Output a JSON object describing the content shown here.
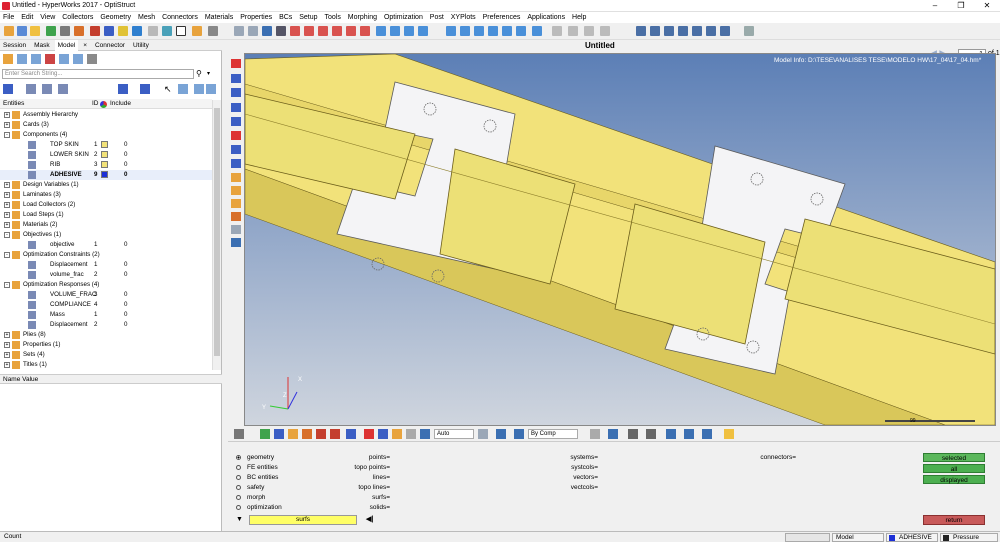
{
  "window": {
    "title": "Untitled - HyperWorks 2017 - OptiStruct"
  },
  "menu": [
    "File",
    "Edit",
    "View",
    "Collectors",
    "Geometry",
    "Mesh",
    "Connectors",
    "Materials",
    "Properties",
    "BCs",
    "Setup",
    "Tools",
    "Morphing",
    "Optimization",
    "Post",
    "XYPlots",
    "Preferences",
    "Applications",
    "Help"
  ],
  "pager": {
    "value": "1",
    "of": "of 1"
  },
  "graphics": {
    "title": "Untitled",
    "model_info": "Model Info: D:\\TESE\\ANALISES TESE\\MODELO HW\\17_04\\17_04.hm*",
    "scale": "99"
  },
  "browser": {
    "tabs": [
      "Session",
      "Mask",
      "Model",
      "Connector",
      "Utility"
    ],
    "active_tab": "Model",
    "search_placeholder": "Enter Search String...",
    "columns": {
      "entities": "Entities",
      "id": "ID",
      "include": "Include"
    },
    "tree": [
      {
        "label": "Assembly Hierarchy",
        "level": 0,
        "toggle": "+"
      },
      {
        "label": "Cards (3)",
        "level": 0,
        "toggle": "+"
      },
      {
        "label": "Components (4)",
        "level": 0,
        "toggle": "-"
      },
      {
        "label": "TOP SKIN",
        "level": 1,
        "id": "1",
        "include": "0",
        "color": "#f2e27a"
      },
      {
        "label": "LOWER SKIN",
        "level": 1,
        "id": "2",
        "include": "0",
        "color": "#f2e27a"
      },
      {
        "label": "RIB",
        "level": 1,
        "id": "3",
        "include": "0",
        "color": "#f2e27a"
      },
      {
        "label": "ADHESIVE",
        "level": 1,
        "id": "9",
        "include": "0",
        "color": "#1c2fd6",
        "bold": true
      },
      {
        "label": "Design Variables (1)",
        "level": 0,
        "toggle": "+"
      },
      {
        "label": "Laminates (3)",
        "level": 0,
        "toggle": "+"
      },
      {
        "label": "Load Collectors (2)",
        "level": 0,
        "toggle": "+"
      },
      {
        "label": "Load Steps (1)",
        "level": 0,
        "toggle": "+"
      },
      {
        "label": "Materials (2)",
        "level": 0,
        "toggle": "+"
      },
      {
        "label": "Objectives (1)",
        "level": 0,
        "toggle": "-"
      },
      {
        "label": "objective",
        "level": 1,
        "id": "1",
        "include": "0"
      },
      {
        "label": "Optimization Constraints (2)",
        "level": 0,
        "toggle": "-"
      },
      {
        "label": "Displacement",
        "level": 1,
        "id": "1",
        "include": "0"
      },
      {
        "label": "volume_frac",
        "level": 1,
        "id": "2",
        "include": "0"
      },
      {
        "label": "Optimization Responses (4)",
        "level": 0,
        "toggle": "-"
      },
      {
        "label": "VOLUME_FRAC",
        "level": 1,
        "id": "3",
        "include": "0"
      },
      {
        "label": "COMPLIANCE",
        "level": 1,
        "id": "4",
        "include": "0"
      },
      {
        "label": "Mass",
        "level": 1,
        "id": "1",
        "include": "0"
      },
      {
        "label": "Displacement",
        "level": 1,
        "id": "2",
        "include": "0"
      },
      {
        "label": "Plies (8)",
        "level": 0,
        "toggle": "+"
      },
      {
        "label": "Properties (1)",
        "level": 0,
        "toggle": "+"
      },
      {
        "label": "Sets (4)",
        "level": 0,
        "toggle": "+"
      },
      {
        "label": "Titles (1)",
        "level": 0,
        "toggle": "+"
      }
    ],
    "name_value_header": "Name Value"
  },
  "bottom_toolbar": {
    "auto_select": "Auto",
    "by_comp_select": "By Comp"
  },
  "panel": {
    "radios": [
      "geometry",
      "FE entities",
      "BC entities",
      "safety",
      "morph",
      "optimization"
    ],
    "selected_radio": "geometry",
    "col1": [
      "points=",
      "topo points=",
      "lines=",
      "topo lines=",
      "surfs=",
      "solids="
    ],
    "col2": [
      "systems=",
      "systcols=",
      "vectors=",
      "vectcols="
    ],
    "col3": [
      "connectors="
    ],
    "surfs_box": "surfs",
    "buttons": {
      "selected": "selected",
      "all": "all",
      "displayed": "displayed",
      "return": "return"
    }
  },
  "status": {
    "left": "Count",
    "model": "Model",
    "component": "ADHESIVE",
    "load": "Pressure"
  },
  "colors": {
    "background_top": "#5c7fb6",
    "background_bottom": "#cfd5de",
    "component": "#f2e27a",
    "adhesive_plate": "#f4f4f6",
    "accent_green": "#4caf50",
    "return_red": "#c85a5a"
  }
}
